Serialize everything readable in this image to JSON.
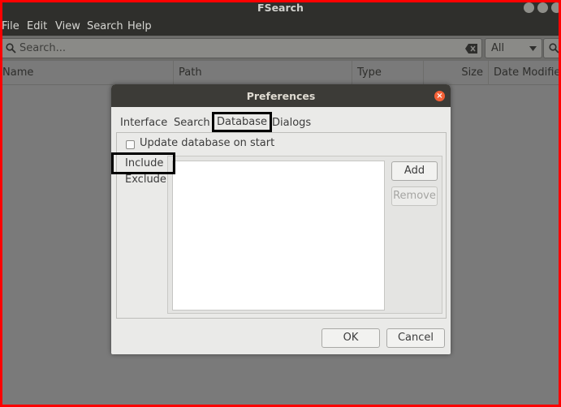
{
  "window": {
    "title": "FSearch"
  },
  "menu": [
    "File",
    "Edit",
    "View",
    "Search",
    "Help"
  ],
  "search": {
    "placeholder": "Search...",
    "filter": "All"
  },
  "columns": [
    "Name",
    "Path",
    "Type",
    "Size",
    "Date Modified"
  ],
  "dialog": {
    "title": "Preferences",
    "tabs": [
      "Interface",
      "Search",
      "Database",
      "Dialogs"
    ],
    "selected_tab": "Database",
    "update_on_start_label": "Update database on start",
    "update_on_start_checked": false,
    "side_tabs": [
      "Include",
      "Exclude"
    ],
    "selected_side_tab": "Include",
    "add_label": "Add",
    "remove_label": "Remove",
    "ok_label": "OK",
    "cancel_label": "Cancel"
  },
  "icons": {
    "search": "search-icon",
    "clear": "clear-icon",
    "dropdown": "chevron-down-icon",
    "close": "close-icon",
    "checkbox": "checkbox-icon"
  },
  "colors": {
    "outer_border": "#ff0000",
    "dialog_close": "#f46036",
    "highlight_box": "#000000"
  }
}
